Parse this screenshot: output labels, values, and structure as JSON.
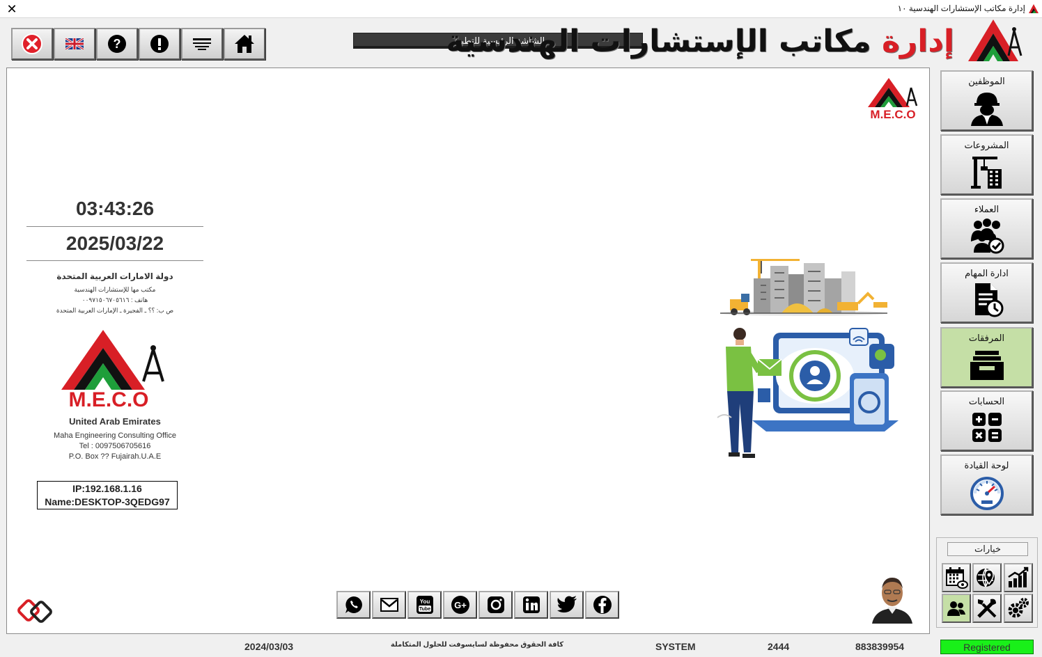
{
  "window": {
    "title": "إدارة مكاتب الإستشارات الهندسية ١٠",
    "close_glyph": "✕"
  },
  "toolbar": {
    "buttons": [
      {
        "name": "exit",
        "icon": "red-x-circle-icon"
      },
      {
        "name": "language",
        "icon": "uk-flag-icon"
      },
      {
        "name": "help",
        "icon": "question-icon"
      },
      {
        "name": "about",
        "icon": "exclamation-icon"
      },
      {
        "name": "menu",
        "icon": "menu-lines-icon"
      },
      {
        "name": "home",
        "icon": "home-icon"
      }
    ]
  },
  "header": {
    "screen_label": "الشاشة الرئيسية للتطبيق",
    "brand_red": "إدارة",
    "brand_black": "مكاتب الإستشارات الهندسية"
  },
  "info": {
    "time": "03:43:26",
    "date": "2025/03/22",
    "country_ar": "دولة الامارات العربية المتحدة",
    "office_ar": "مكتب مها للإستشارات الهندسية",
    "phone_ar": "هاتف : ٠٠٩٧١٥٠٦٧٠٥٦١٦",
    "pobox_ar": "ص ب: ؟؟ ـ الفجيرة ـ الإمارات العربية المتحدة",
    "logo_text": "M.E.C.O",
    "country_en": "United Arab Emirates",
    "office_en": "Maha Engineering Consulting Office",
    "tel_en": "Tel : 0097506705616",
    "pobox_en": "P.O. Box ?? Fujairah.U.A.E",
    "ip": "IP:192.168.1.16",
    "machine": "Name:DESKTOP-3QEDG97"
  },
  "corner_logo_text": "M.E.C.O",
  "social": [
    "whatsapp-icon",
    "mail-icon",
    "youtube-icon",
    "google-plus-icon",
    "instagram-icon",
    "linkedin-icon",
    "twitter-icon",
    "facebook-icon"
  ],
  "sidebar": {
    "items": [
      {
        "label": "الموظفين",
        "icon": "engineer-icon"
      },
      {
        "label": "المشروعات",
        "icon": "crane-building-icon"
      },
      {
        "label": "العملاء",
        "icon": "clients-group-icon"
      },
      {
        "label": "ادارة المهام",
        "icon": "task-document-icon"
      },
      {
        "label": "المرفقات",
        "icon": "inbox-tray-icon",
        "active": true
      },
      {
        "label": "الحسابات",
        "icon": "calculator-icon"
      },
      {
        "label": "لوحة القيادة",
        "icon": "gauge-icon"
      }
    ],
    "options_label": "خيارات",
    "options": [
      "calendar-eye-icon",
      "globe-pin-icon",
      "bar-chart-icon",
      "users-icon",
      "tools-icon",
      "gears-icon"
    ]
  },
  "status": {
    "date": "2024/03/03",
    "copyright": "كافة الحقوق محفوظة لسايسوفت للحلول المتكاملة",
    "user": "SYSTEM",
    "code": "2444",
    "serial": "883839954",
    "registered": "Registered"
  },
  "colors": {
    "brand_red": "#d81f26",
    "brand_green": "#1e9e3a",
    "active_sidebar": "#c5dfa6",
    "registered_green": "#19f019",
    "label_bar": "#3b3b3b"
  }
}
